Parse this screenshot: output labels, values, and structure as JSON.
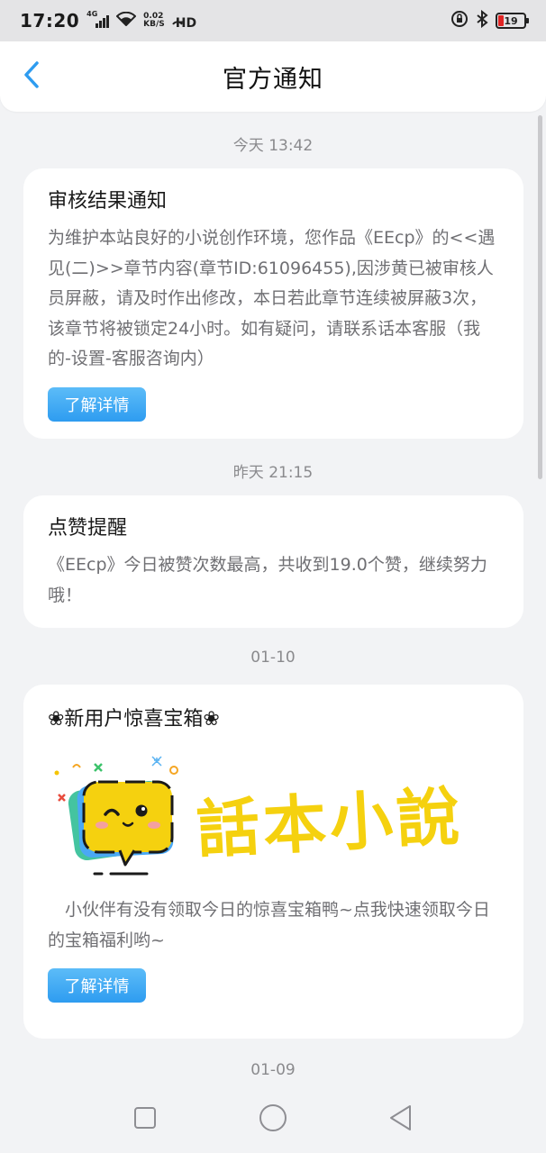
{
  "status_bar": {
    "time": "17:20",
    "network": "4G",
    "speed_value": "0.02",
    "speed_unit": "KB/S",
    "hd": "HD",
    "battery": "19"
  },
  "header": {
    "title": "官方通知"
  },
  "notifications": [
    {
      "time": "今天 13:42",
      "title": "审核结果通知",
      "body": "为维护本站良好的小说创作环境，您作品《EEcp》的<<遇见(二)>>章节内容(章节ID:61096455),因涉黄已被审核人员屏蔽，请及时作出修改，本日若此章节连续被屏蔽3次，该章节将被锁定24小时。如有疑问，请联系话本客服（我的-设置-客服咨询内）",
      "button": "了解详情"
    },
    {
      "time": "昨天 21:15",
      "title": "点赞提醒",
      "body": "《EEcp》今日被赞次数最高，共收到19.0个赞，继续努力哦！"
    },
    {
      "time": "01-10",
      "title": "❀新用户惊喜宝箱❀",
      "logo_text": "話本小說",
      "body": "　小伙伴有没有领取今日的惊喜宝箱鸭~点我快速领取今日的宝箱福利哟~",
      "button": "了解详情"
    },
    {
      "time": "01-09"
    }
  ],
  "colors": {
    "accent": "#2e9cf0",
    "background": "#f2f3f5",
    "logo_yellow": "#f5d10f"
  }
}
